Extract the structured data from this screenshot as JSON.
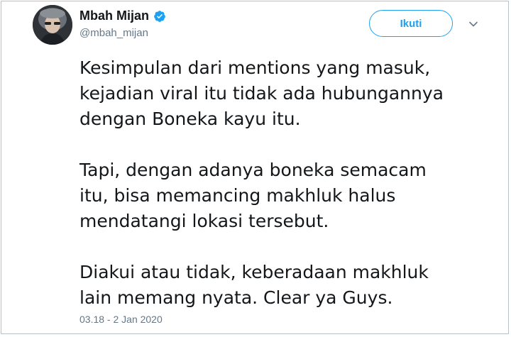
{
  "user": {
    "display_name": "Mbah Mijan",
    "handle": "@mbah_mijan",
    "verified_badge": "verified-check-icon"
  },
  "actions": {
    "follow_label": "Ikuti",
    "more_icon": "chevron-down-icon"
  },
  "tweet": {
    "paragraphs": [
      {
        "lines": [
          "Kesimpulan dari mentions yang masuk,",
          "kejadian viral itu tidak ada hubungannya",
          "dengan Boneka kayu itu."
        ]
      },
      {
        "lines": [
          "Tapi, dengan adanya boneka semacam",
          "itu, bisa memancing makhluk halus",
          "mendatangi lokasi tersebut."
        ]
      },
      {
        "lines": [
          "Diakui atau tidak, keberadaan makhluk",
          "lain memang nyata. Clear ya Guys."
        ]
      }
    ],
    "timestamp": "03.18 - 2 Jan 2020"
  },
  "colors": {
    "accent": "#1da1f2",
    "muted": "#657786",
    "text": "#14171a",
    "border": "#b9c1c8"
  }
}
